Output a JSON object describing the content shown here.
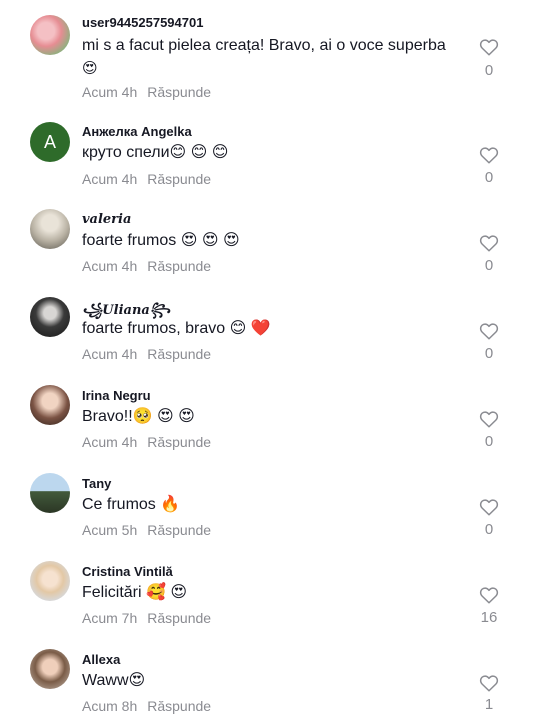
{
  "comments": [
    {
      "username": "user9445257594701",
      "avatar": "flowers-photo",
      "text": "mi s a facut pielea creața! Bravo, ai o voce superba",
      "text_line2": "😍",
      "time": "Acum 4h",
      "reply": "Răspunde",
      "likes": "0"
    },
    {
      "username": "Анжелка Angelka",
      "avatar_letter": "A",
      "text": "круто спели😊 😊 😊",
      "time": "Acum 4h",
      "reply": "Răspunde",
      "likes": "0"
    },
    {
      "username": "𝒗𝒂𝒍𝒆𝒓𝒊𝒂",
      "avatar": "person-photo",
      "text": "foarte frumos 😍 😍 😍",
      "time": "Acum 4h",
      "reply": "Răspunde",
      "likes": "0"
    },
    {
      "username": "꧁𝑼𝒍𝒊𝒂𝒏𝒂꧂",
      "avatar": "person-photo",
      "text": "foarte frumos, bravo 😊 ❤️",
      "time": "Acum 4h",
      "reply": "Răspunde",
      "likes": "0"
    },
    {
      "username": "Irina Negru",
      "avatar": "person-photo",
      "text": "Bravo!!🥺 😍 😍",
      "time": "Acum 4h",
      "reply": "Răspunde",
      "likes": "0"
    },
    {
      "username": "Tany",
      "avatar": "person-photo",
      "text": "Ce frumos 🔥",
      "time": "Acum 5h",
      "reply": "Răspunde",
      "likes": "0"
    },
    {
      "username": "Cristina Vintilă",
      "avatar": "person-photo",
      "text": "Felicitări 🥰 😍",
      "time": "Acum 7h",
      "reply": "Răspunde",
      "likes": "16"
    },
    {
      "username": "Allexa",
      "avatar": "person-photo",
      "text": "Waww😍",
      "time": "Acum 8h",
      "reply": "Răspunde",
      "likes": "1"
    }
  ],
  "colors": {
    "username": "#161823",
    "meta": "#8a8b91",
    "avatar_letter_bg": "#2e6b2a"
  },
  "icons": {
    "like": "heart-outline-icon"
  }
}
